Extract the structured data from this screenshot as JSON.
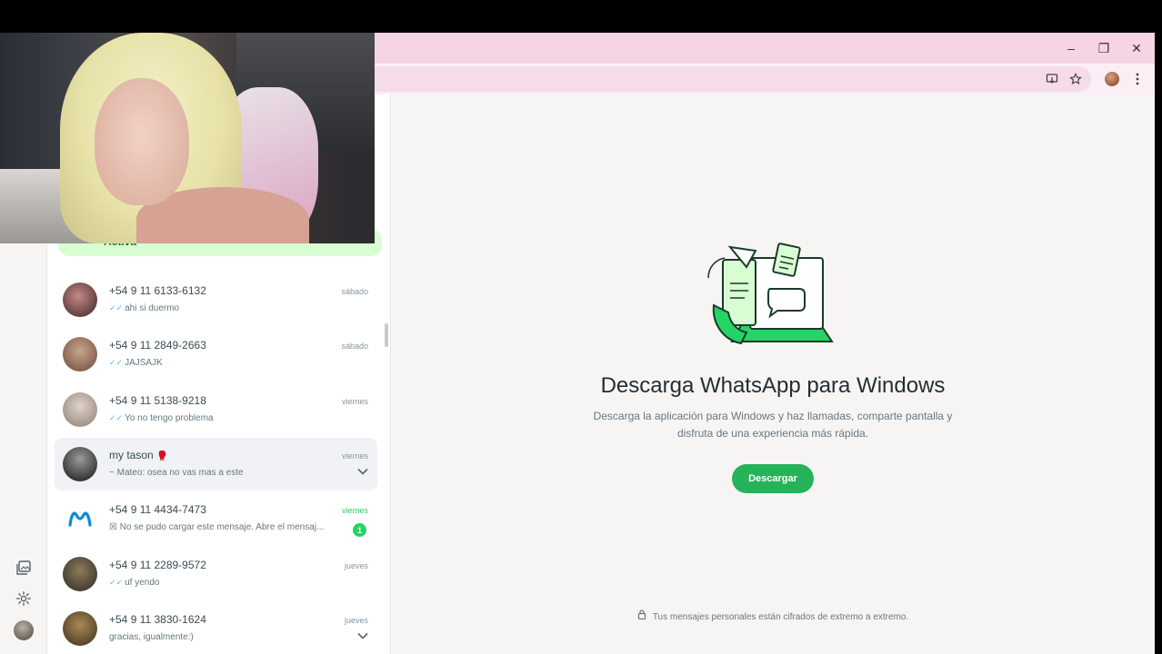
{
  "window": {
    "controls": {
      "minimize": "–",
      "restore": "❐",
      "close": "✕"
    }
  },
  "toolbar": {
    "icons": [
      "install-app-icon",
      "bookmark-star-icon",
      "profile-avatar",
      "kebab-menu-icon"
    ]
  },
  "filter": {
    "active_label": "Activa"
  },
  "chats": [
    {
      "name": "+54 9 11 6133-6132",
      "time": "sábado",
      "ticks": "✓✓",
      "preview": "ahi si duermo"
    },
    {
      "name": "+54 9 11 2849-2663",
      "time": "sábado",
      "ticks": "✓✓",
      "preview": "JAJSAJK"
    },
    {
      "name": "+54 9 11 5138-9218",
      "time": "viernes",
      "ticks": "✓✓",
      "preview": "Yo no tengo problema"
    },
    {
      "name": "my tason",
      "flag": "🥊",
      "time": "viernes",
      "ticks": "",
      "preview": "~ Mateo: osea no vas mas a este"
    },
    {
      "name": "+54 9 11 4434-7473",
      "time": "viernes",
      "ticks": "☒",
      "preview": "No se pudo cargar este mensaje. Abre el mensaj...",
      "badge": "1"
    },
    {
      "name": "+54 9 11 2289-9572",
      "time": "jueves",
      "ticks": "✓✓",
      "preview": "uf yendo"
    },
    {
      "name": "+54 9 11 3830-1624",
      "time": "jueves",
      "ticks": "",
      "preview": "gracias, igualmente:)"
    }
  ],
  "main": {
    "title": "Descarga WhatsApp para Windows",
    "subtitle": "Descarga la aplicación para Windows y haz llamadas, comparte pantalla y disfruta de una experiencia más rápida.",
    "button": "Descargar",
    "footer": "Tus mensajes personales están cifrados de extremo a extremo."
  },
  "colors": {
    "accent": "#25b35a",
    "tab_strip": "#f7d3e6",
    "active_filter": "#d9fdd3",
    "unread_badge": "#25d366"
  }
}
